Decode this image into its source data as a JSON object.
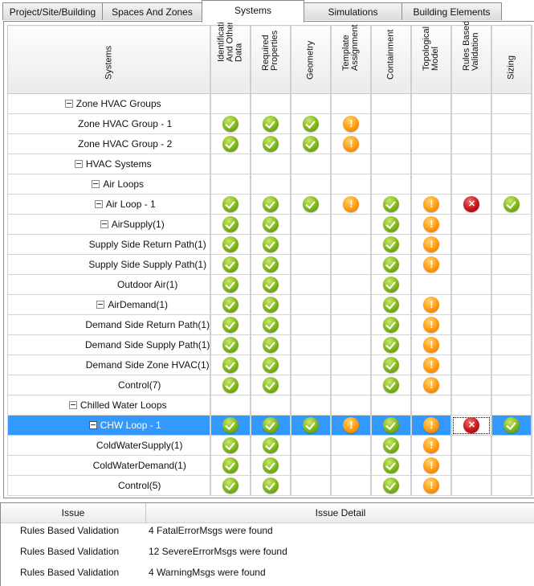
{
  "tabs": [
    {
      "label": "Project/Site/Building",
      "active": false
    },
    {
      "label": "Spaces And Zones",
      "active": false
    },
    {
      "label": "Systems",
      "active": true
    },
    {
      "label": "Simulations",
      "active": false
    },
    {
      "label": "Building Elements",
      "active": false
    }
  ],
  "grid": {
    "name_column": "Systems",
    "columns": [
      "Identification\nAnd Other\nData",
      "Required\nProperties",
      "Geometry",
      "Template\nAssignment",
      "Containment",
      "Topological\nModel",
      "Rules Based\nValidation",
      "Sizing"
    ],
    "rows": [
      {
        "label": "Zone HVAC Groups",
        "level": 0,
        "expander": true,
        "status": [
          "",
          "",
          "",
          "",
          "",
          "",
          "",
          ""
        ]
      },
      {
        "label": "Zone HVAC Group - 1",
        "level": 2,
        "expander": false,
        "status": [
          "ok",
          "ok",
          "ok",
          "warn",
          "",
          "",
          "",
          ""
        ]
      },
      {
        "label": "Zone HVAC Group - 2",
        "level": 2,
        "expander": false,
        "status": [
          "ok",
          "ok",
          "ok",
          "warn",
          "",
          "",
          "",
          ""
        ]
      },
      {
        "label": "HVAC Systems",
        "level": 0,
        "expander": true,
        "status": [
          "",
          "",
          "",
          "",
          "",
          "",
          "",
          ""
        ]
      },
      {
        "label": "Air Loops",
        "level": 1,
        "expander": true,
        "status": [
          "",
          "",
          "",
          "",
          "",
          "",
          "",
          ""
        ]
      },
      {
        "label": "Air Loop - 1",
        "level": 2,
        "expander": true,
        "status": [
          "ok",
          "ok",
          "ok",
          "warn",
          "ok",
          "warn",
          "err",
          "ok"
        ]
      },
      {
        "label": "AirSupply(1)",
        "level": 3,
        "expander": true,
        "status": [
          "ok",
          "ok",
          "",
          "",
          "ok",
          "warn",
          "",
          ""
        ]
      },
      {
        "label": "Supply Side Return Path(1)",
        "level": 5,
        "expander": false,
        "status": [
          "ok",
          "ok",
          "",
          "",
          "ok",
          "warn",
          "",
          ""
        ]
      },
      {
        "label": "Supply Side Supply Path(1)",
        "level": 5,
        "expander": false,
        "status": [
          "ok",
          "ok",
          "",
          "",
          "ok",
          "warn",
          "",
          ""
        ]
      },
      {
        "label": "Outdoor Air(1)",
        "level": 5,
        "expander": false,
        "status": [
          "ok",
          "ok",
          "",
          "",
          "ok",
          "",
          "",
          ""
        ]
      },
      {
        "label": "AirDemand(1)",
        "level": 3,
        "expander": true,
        "status": [
          "ok",
          "ok",
          "",
          "",
          "ok",
          "warn",
          "",
          ""
        ]
      },
      {
        "label": "Demand Side Return Path(1)",
        "level": 5,
        "expander": false,
        "status": [
          "ok",
          "ok",
          "",
          "",
          "ok",
          "warn",
          "",
          ""
        ]
      },
      {
        "label": "Demand Side Supply Path(1)",
        "level": 5,
        "expander": false,
        "status": [
          "ok",
          "ok",
          "",
          "",
          "ok",
          "warn",
          "",
          ""
        ]
      },
      {
        "label": "Demand Side Zone HVAC(1)",
        "level": 5,
        "expander": false,
        "status": [
          "ok",
          "ok",
          "",
          "",
          "ok",
          "warn",
          "",
          ""
        ]
      },
      {
        "label": "Control(7)",
        "level": 4,
        "expander": false,
        "status": [
          "ok",
          "ok",
          "",
          "",
          "ok",
          "warn",
          "",
          ""
        ]
      },
      {
        "label": "Chilled Water Loops",
        "level": 1,
        "expander": true,
        "status": [
          "",
          "",
          "",
          "",
          "",
          "",
          "",
          ""
        ]
      },
      {
        "label": "CHW Loop - 1",
        "level": 2,
        "expander": true,
        "selected": true,
        "status": [
          "ok",
          "ok",
          "ok",
          "warn",
          "ok",
          "warn",
          "err",
          "ok"
        ]
      },
      {
        "label": "ColdWaterSupply(1)",
        "level": 4,
        "expander": false,
        "status": [
          "ok",
          "ok",
          "",
          "",
          "ok",
          "warn",
          "",
          ""
        ]
      },
      {
        "label": "ColdWaterDemand(1)",
        "level": 4,
        "expander": false,
        "status": [
          "ok",
          "ok",
          "",
          "",
          "ok",
          "warn",
          "",
          ""
        ]
      },
      {
        "label": "Control(5)",
        "level": 4,
        "expander": false,
        "status": [
          "ok",
          "ok",
          "",
          "",
          "ok",
          "warn",
          "",
          ""
        ]
      }
    ]
  },
  "status_icons": {
    "ok": "check-circle-icon",
    "warn": "exclamation-circle-icon",
    "err": "x-circle-icon"
  },
  "colors": {
    "selection": "#3399ff",
    "ok": "#7fb51a",
    "warn": "#ff9a10",
    "err": "#c8151a"
  },
  "issues": {
    "headers": {
      "issue": "Issue",
      "detail": "Issue Detail"
    },
    "rows": [
      {
        "issue": "Rules Based Validation",
        "detail": "4 FatalErrorMsgs were found"
      },
      {
        "issue": "Rules Based Validation",
        "detail": "12 SevereErrorMsgs were found"
      },
      {
        "issue": "Rules Based Validation",
        "detail": "4 WarningMsgs were found"
      }
    ]
  }
}
